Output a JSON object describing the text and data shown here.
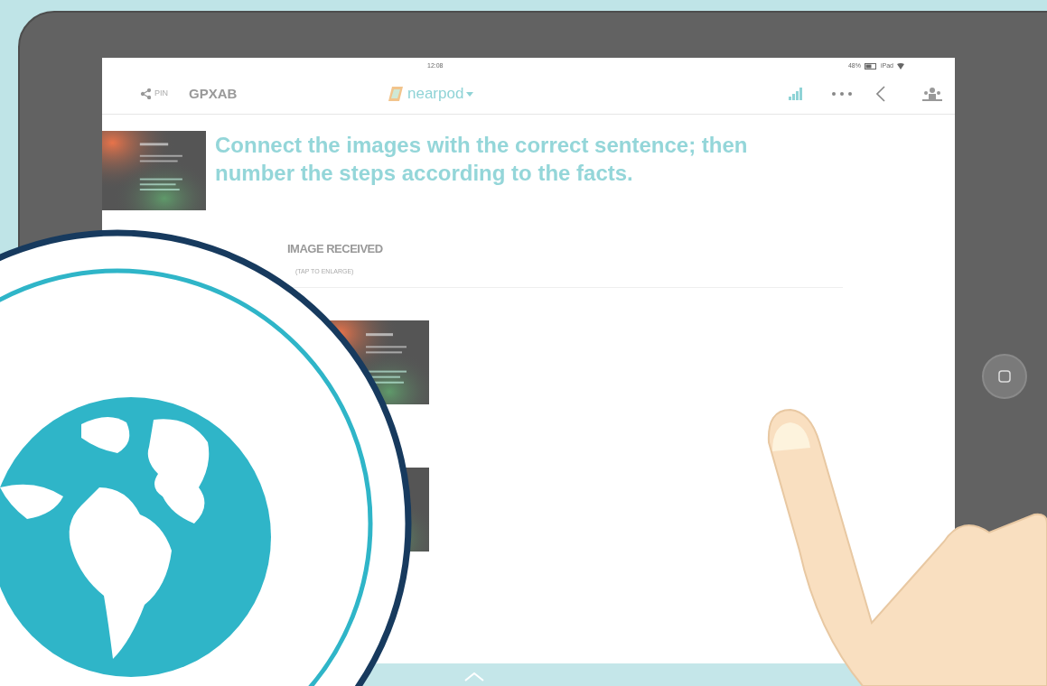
{
  "status_bar": {
    "time": "12:08",
    "battery": "48%",
    "device": "iPad"
  },
  "toolbar": {
    "pin_label": "PIN",
    "pin_code": "GPXAB",
    "logo": "nearpod"
  },
  "question": {
    "text": "Connect the images with the correct sentence; then number the steps according to the facts."
  },
  "response": {
    "title": "IMAGE RECEIVED",
    "hint": "(TAP TO ENLARGE)"
  }
}
